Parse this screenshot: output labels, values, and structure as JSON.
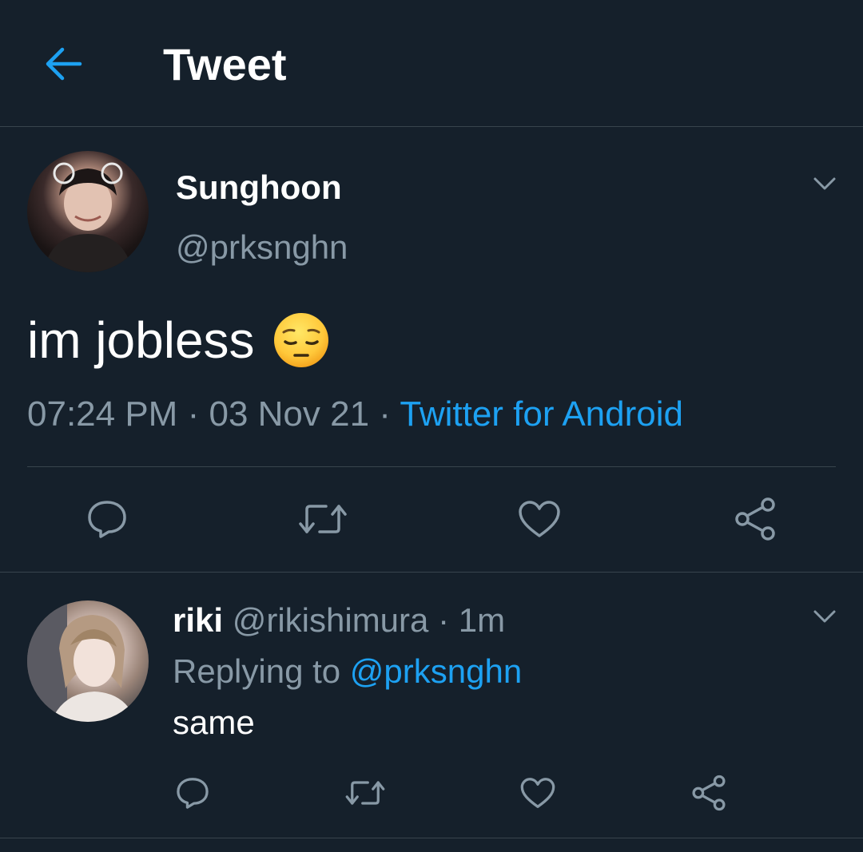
{
  "header": {
    "title": "Tweet",
    "back_icon": "arrow-left-icon"
  },
  "colors": {
    "background": "#15202b",
    "accent": "#1da1f2",
    "secondary_text": "#8899a6",
    "divider": "#38444d"
  },
  "main_tweet": {
    "display_name": "Sunghoon",
    "handle": "@prksnghn",
    "text": "im jobless",
    "emoji": "pensive-face-emoji",
    "time": "07:24 PM",
    "separator": "·",
    "date": "03 Nov 21",
    "source": "Twitter for Android",
    "actions": [
      "reply-icon",
      "retweet-icon",
      "like-icon",
      "share-icon"
    ]
  },
  "reply": {
    "display_name": "riki",
    "handle": "@rikishimura",
    "separator": "·",
    "age": "1m",
    "replying_label": "Replying to",
    "replying_to": "@prksnghn",
    "text": "same",
    "actions": [
      "reply-icon",
      "retweet-icon",
      "like-icon",
      "share-icon"
    ]
  }
}
